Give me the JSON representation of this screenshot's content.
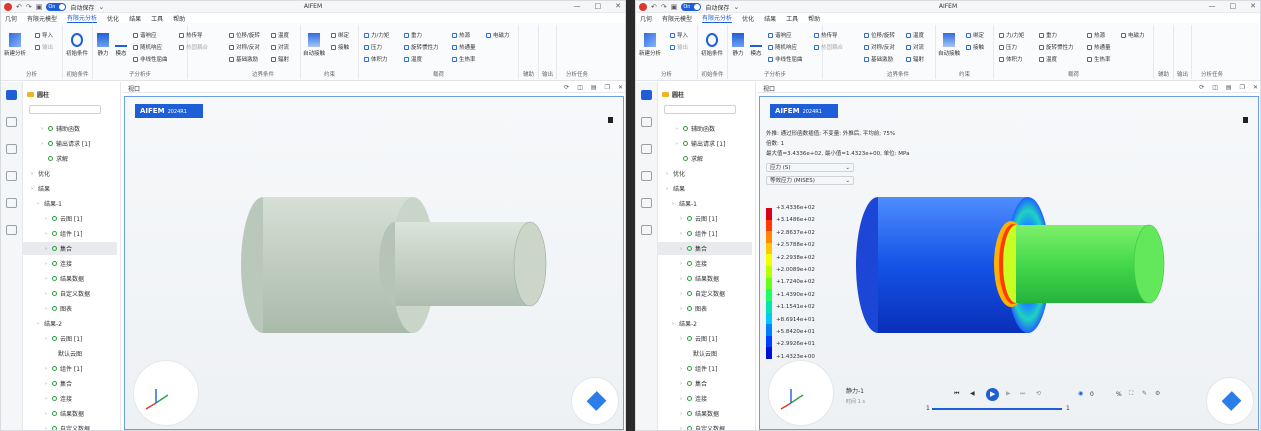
{
  "app": {
    "title": "AIFEM",
    "autosave_label": "自动保存",
    "toggle_label": "On"
  },
  "menu": [
    "几何",
    "有限元模型",
    "有限元分析",
    "优化",
    "结果",
    "工具",
    "帮助"
  ],
  "menu_active": "有限元分析",
  "ribbon": {
    "groups": [
      "分析",
      "初始条件",
      "子分析步",
      "边界条件",
      "约束",
      "载荷",
      "辅助",
      "输出",
      "分析任务"
    ],
    "analysis": {
      "new": "新建分析",
      "import": "导入",
      "export": "输出"
    },
    "initial": {
      "label": "初始条件"
    },
    "substep": {
      "static": "静力",
      "modal": "模态",
      "harmonic": "谐响应",
      "random": "随机响应",
      "nonlinear": "非线性屈曲",
      "heat": "热传导",
      "thermal_coupling": "热固耦合"
    },
    "boundary": {
      "displacement": "位移/旋转",
      "symmetry": "对称/反对",
      "base": "基础激励",
      "temperature": "温度",
      "convection": "对流",
      "radiation": "辐射"
    },
    "constraint": {
      "auto_contact": "自动接触",
      "bind": "绑定",
      "contact": "接触"
    },
    "load": {
      "force": "力/力矩",
      "pressure": "压力",
      "body_force": "体积力",
      "gravity": "重力",
      "rotational_inertia": "旋转惯性力",
      "temperature": "温度",
      "heat_source": "热源",
      "heat_flux": "热通量",
      "heat_gen": "生热率",
      "em_force": "电磁力"
    }
  },
  "tree": {
    "root": "圆柱",
    "search_placeholder": "",
    "items_left": [
      {
        "label": "辅助函数",
        "checked": true
      },
      {
        "label": "输出请求 [1]",
        "checked": true
      },
      {
        "label": "求解",
        "checked": true
      },
      {
        "label": "优化",
        "checked": false
      },
      {
        "label": "结果",
        "checked": false
      },
      {
        "label": "结果-1",
        "checked": false
      },
      {
        "label": "云图 [1]",
        "checked": true
      },
      {
        "label": "组件 [1]",
        "checked": true
      },
      {
        "label": "集合",
        "checked": true
      },
      {
        "label": "连接",
        "checked": true
      },
      {
        "label": "结果数据",
        "checked": true
      },
      {
        "label": "自定义数据",
        "checked": true
      },
      {
        "label": "图表",
        "checked": true
      },
      {
        "label": "结果-2",
        "checked": false
      },
      {
        "label": "云图 [1]",
        "checked": true
      },
      {
        "label": "默认云图",
        "checked": false
      },
      {
        "label": "组件 [1]",
        "checked": true
      },
      {
        "label": "集合",
        "checked": true
      },
      {
        "label": "连接",
        "checked": true
      },
      {
        "label": "结果数据",
        "checked": true
      },
      {
        "label": "自定义数据",
        "checked": true
      }
    ]
  },
  "viewport": {
    "title": "视口",
    "badge": "AIFEM",
    "version": "2024R1"
  },
  "result": {
    "info_line1": "外推: 通过形函数插值; 不变量: 外推后, 平均前; 75%",
    "info_line2": "倍数: 1",
    "info_line3": "最大值=3.4336e+02, 最小值=1.4323e+00, 单位: MPa",
    "select_variable": "应力 (S)",
    "select_component": "等效应力 (MISES)",
    "legend_values": [
      "+3.4336e+02",
      "+3.1486e+02",
      "+2.8637e+02",
      "+2.5788e+02",
      "+2.2938e+02",
      "+2.0089e+02",
      "+1.7240e+02",
      "+1.4390e+02",
      "+1.1541e+02",
      "+8.6914e+01",
      "+5.8420e+01",
      "+2.9926e+01",
      "+1.4323e+00"
    ],
    "legend_colors": [
      "#d8001a",
      "#ff3b00",
      "#ff8a00",
      "#ffc800",
      "#f5ff00",
      "#b8ff00",
      "#66ff1a",
      "#1aff66",
      "#00e6b3",
      "#00c8ff",
      "#0080ff",
      "#0040ff",
      "#0010d0"
    ],
    "anim_title": "静力-1",
    "anim_time": "时间 1 s",
    "slider_start": "1",
    "slider_end": "1",
    "speed": "0",
    "speed_unit": "%"
  },
  "colors": {
    "accent": "#1e5fd8",
    "shaft": "#c5d3c6"
  }
}
